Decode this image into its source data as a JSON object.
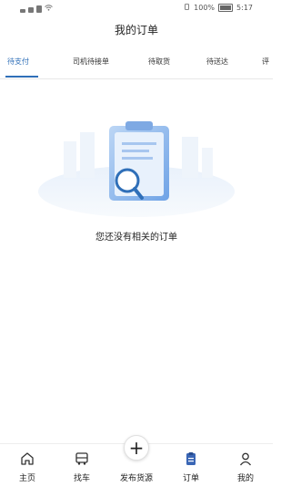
{
  "status_bar": {
    "battery_text": "100%",
    "time": "5:17"
  },
  "header": {
    "title": "我的订单"
  },
  "tabs": [
    {
      "label": "待支付",
      "active": true
    },
    {
      "label": "司机待接单",
      "active": false
    },
    {
      "label": "待取货",
      "active": false
    },
    {
      "label": "待送达",
      "active": false
    },
    {
      "label": "评",
      "active": false
    }
  ],
  "empty_state": {
    "message": "您还没有相关的订单",
    "icon": "clipboard-search-illustration"
  },
  "bottom_nav": [
    {
      "label": "主页",
      "icon": "home-icon"
    },
    {
      "label": "找车",
      "icon": "truck-icon"
    },
    {
      "label": "发布货源",
      "icon": "plus-icon"
    },
    {
      "label": "订单",
      "icon": "clipboard-icon",
      "active": true
    },
    {
      "label": "我的",
      "icon": "person-icon"
    }
  ],
  "colors": {
    "accent": "#2f6fb8",
    "nav_active_icon": "#3a66b5"
  }
}
